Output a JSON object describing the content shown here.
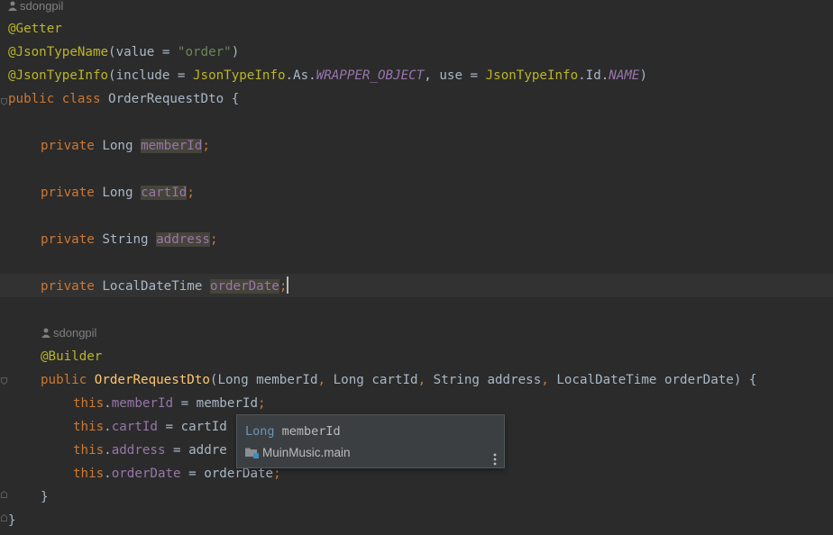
{
  "editor": {
    "author_top": "sdongpil",
    "author_ctor": "sdongpil",
    "annotations": {
      "getter": "@Getter",
      "json_type_name": "@JsonTypeName",
      "json_type_name_args_open": "(value = ",
      "json_type_name_value": "\"order\"",
      "json_type_name_args_close": ")",
      "json_type_info": "@JsonTypeInfo",
      "json_type_info_p1": "(include = ",
      "json_type_info_cls1": "JsonTypeInfo",
      "json_type_info_p2": ".As.",
      "json_type_info_const1": "WRAPPER_OBJECT",
      "json_type_info_p3": ", use = ",
      "json_type_info_cls2": "JsonTypeInfo",
      "json_type_info_p4": ".Id.",
      "json_type_info_const2": "NAME",
      "json_type_info_p5": ")",
      "builder": "@Builder"
    },
    "class_decl": {
      "kw": "public class ",
      "name": "OrderRequestDto",
      "open": " {"
    },
    "fields": [
      {
        "kw": "private ",
        "type": "Long ",
        "name": "memberId",
        "semi": ";"
      },
      {
        "kw": "private ",
        "type": "Long ",
        "name": "cartId",
        "semi": ";"
      },
      {
        "kw": "private ",
        "type": "String ",
        "name": "address",
        "semi": ";"
      },
      {
        "kw": "private ",
        "type": "LocalDateTime ",
        "name": "orderDate",
        "semi": ";"
      }
    ],
    "ctor": {
      "kw": "public ",
      "name": "OrderRequestDto",
      "p_open": "(Long memberId",
      "c1": ", ",
      "p2": "Long cartId",
      "c2": ", ",
      "p3": "String address",
      "c3": ", ",
      "p4": "LocalDateTime orderDate",
      "p_close": ") {"
    },
    "body": [
      {
        "this": "this",
        "dot": ".",
        "field": "memberId",
        "rest": " = memberId",
        "semi": ";"
      },
      {
        "this": "this",
        "dot": ".",
        "field": "cartId",
        "rest": " = cartId",
        "semi": ""
      },
      {
        "this": "this",
        "dot": ".",
        "field": "address",
        "rest": " = addre",
        "semi": ""
      },
      {
        "this": "this",
        "dot": ".",
        "field": "orderDate",
        "rest": " = orderDate",
        "semi": ";"
      }
    ],
    "close_ctor": "}",
    "close_class": "}"
  },
  "popup": {
    "type": "Long",
    "name": " memberId",
    "module": "MuinMusic.main",
    "icon": "module-folder-icon"
  },
  "colors": {
    "background": "#2b2b2b",
    "keyword": "#cc7832",
    "annotation": "#bbb529",
    "string": "#6a8759",
    "field": "#9876aa",
    "method": "#ffc66d",
    "text": "#a9b7c6"
  }
}
